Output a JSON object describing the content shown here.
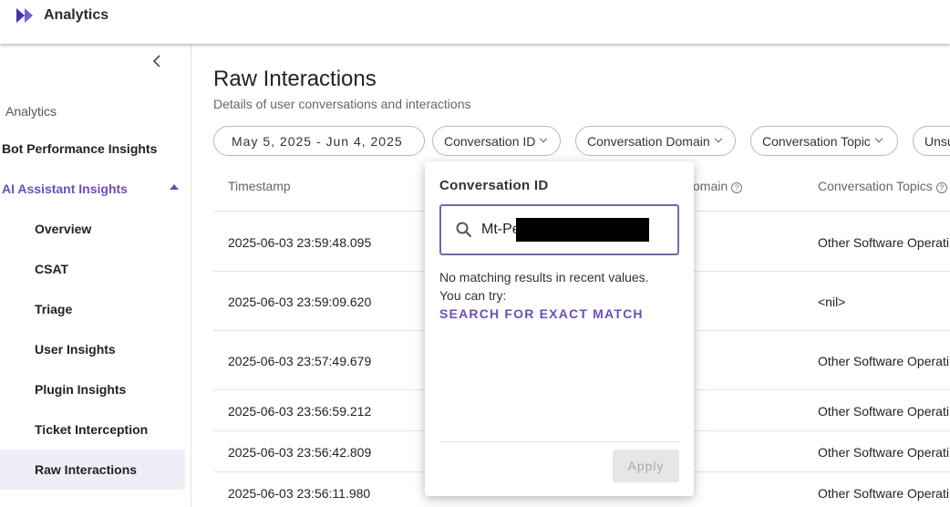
{
  "app": {
    "title": "Analytics",
    "brand_color": "#6b4fbb"
  },
  "sidebar": {
    "section_label": "Analytics",
    "items": [
      {
        "label": "Bot Performance Insights"
      },
      {
        "label": "AI Assistant Insights"
      },
      {
        "label": "Overview"
      },
      {
        "label": "CSAT"
      },
      {
        "label": "Triage"
      },
      {
        "label": "User Insights"
      },
      {
        "label": "Plugin Insights"
      },
      {
        "label": "Ticket Interception"
      },
      {
        "label": "Raw Interactions"
      }
    ]
  },
  "page": {
    "title": "Raw Interactions",
    "subtitle": "Details of user conversations and interactions"
  },
  "filters": {
    "date_range": "May 5, 2025 - Jun 4, 2025",
    "conversation_id": "Conversation ID",
    "conversation_domain": "Conversation Domain",
    "conversation_topic": "Conversation Topic",
    "truncated": "Unsu"
  },
  "table": {
    "headers": {
      "timestamp": "Timestamp",
      "domain": "omain",
      "topics": "Conversation Topics"
    },
    "rows": [
      {
        "timestamp": "2025-06-03 23:59:48.095",
        "topic": "Other Software Operati"
      },
      {
        "timestamp": "2025-06-03 23:59:09.620",
        "topic": "<nil>"
      },
      {
        "timestamp": "2025-06-03 23:57:49.679",
        "topic": "Other Software Operati"
      },
      {
        "timestamp": "2025-06-03 23:56:59.212",
        "topic": "Other Software Operati"
      },
      {
        "timestamp": "2025-06-03 23:56:42.809",
        "topic": "Other Software Operati"
      },
      {
        "timestamp": "2025-06-03 23:56:11.980",
        "topic": "Other Software Operati"
      }
    ]
  },
  "popover": {
    "title": "Conversation ID",
    "input_value": "Mt-Pe",
    "message_line1": "No matching results in recent values.",
    "message_line2": "You can try:",
    "exact_match_link": "SEARCH FOR EXACT MATCH",
    "apply_label": "Apply"
  }
}
